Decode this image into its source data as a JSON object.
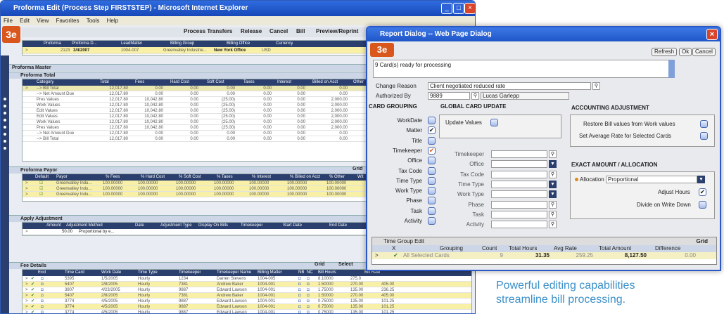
{
  "ie": {
    "title": "Proforma Edit (Process Step FIRSTSTEP) - Microsoft Internet Explorer",
    "menu": [
      "File",
      "Edit",
      "View",
      "Favorites",
      "Tools",
      "Help"
    ],
    "toolbar": [
      "Process Transfers",
      "Release",
      "Cancel",
      "Bill",
      "Preview/Reprint"
    ],
    "proforma_cols": [
      "Proforma",
      "Proforma D...",
      "LeadMatter",
      "Billing Group",
      "Billing Office",
      "Currency"
    ],
    "proforma_row": [
      "2123",
      "3/4/2007",
      "1004-007",
      "Greenvalley Industrie...",
      "New York Office",
      "USD"
    ],
    "proforma_master": "Proforma Master",
    "proforma_total": "Proforma Total",
    "total_cols": [
      "Category",
      "Total",
      "Fees",
      "Hard Cost",
      "Soft Cost",
      "Taxes",
      "Interest",
      "Billed on Acct",
      "Other"
    ],
    "total_rows": [
      [
        "--> Bill Total",
        "12,017.80",
        "0.00",
        "0.00",
        "0.00",
        "0.00",
        "0.00",
        "0.00",
        "0."
      ],
      [
        "--> Net Amount Due",
        "12,017.80",
        "0.00",
        "0.00",
        "0.00",
        "0.00",
        "0.00",
        "0.00",
        "0."
      ],
      [
        "Pres Values",
        "12,017.80",
        "10,042.80",
        "0.00",
        "(25.00)",
        "0.00",
        "0.00",
        "2,000.00",
        "0."
      ],
      [
        "Work Values",
        "12,017.80",
        "10,042.80",
        "0.00",
        "(25.00)",
        "0.00",
        "0.00",
        "2,000.00",
        "0."
      ],
      [
        "Edit Values",
        "12,017.80",
        "10,042.80",
        "0.00",
        "(25.00)",
        "0.00",
        "0.00",
        "2,000.00",
        "0."
      ],
      [
        "Edit Values",
        "12,017.80",
        "10,042.80",
        "0.00",
        "(25.00)",
        "0.00",
        "0.00",
        "2,000.00",
        "0."
      ],
      [
        "Work Values",
        "12,017.80",
        "10,042.80",
        "0.00",
        "(25.00)",
        "0.00",
        "0.00",
        "2,000.00",
        "0."
      ],
      [
        "Pres Values",
        "12,017.80",
        "10,042.80",
        "0.00",
        "(25.00)",
        "0.00",
        "0.00",
        "2,000.00",
        "0."
      ],
      [
        "--> Net Amount Due",
        "12,017.80",
        "0.00",
        "0.00",
        "0.00",
        "0.00",
        "0.00",
        "0.00",
        "0."
      ],
      [
        "--> Bill Total",
        "12,017.80",
        "0.00",
        "0.00",
        "0.00",
        "0.00",
        "0.00",
        "0.00",
        "0."
      ]
    ],
    "payor_title": "Proforma Payor",
    "payor_grid": "Grid",
    "payor_cols": [
      "Default",
      "Payor",
      "% Fees",
      "% Hard Cost",
      "% Soft Cost",
      "% Taxes",
      "% Interest",
      "% Billed on Acct",
      "% Other",
      "Wit"
    ],
    "payor_rows": [
      [
        "Greenvalley Indu...",
        "100.00000",
        "100.00000",
        "100.00000",
        "100.00000",
        "100.00000",
        "100.00000",
        "100.00000"
      ],
      [
        "Greenvalley Indu...",
        "100.00000",
        "100.00000",
        "100.00000",
        "100.00000",
        "100.00000",
        "100.00000",
        "100.00000"
      ],
      [
        "Greenvalley Indu...",
        "100.00000",
        "100.00000",
        "100.00000",
        "100.00000",
        "100.00000",
        "100.00000",
        "100.00000"
      ]
    ],
    "adjust_title": "Apply Adjustment",
    "adjust_cols": [
      "Amount",
      "Adjustment Method",
      "Date",
      "Adjustment Type",
      "Display On Bills",
      "Timekeeper",
      "Start Date",
      "End Date",
      "Time"
    ],
    "adjust_row": [
      "50.00",
      "Proportional by e..."
    ],
    "fee_title": "Fee Details",
    "fee_grid": "Grid",
    "fee_select": "Select",
    "fee_cols": [
      "Excl",
      "Time Card",
      "Work Date",
      "Time Type",
      "Timekeeper",
      "Timekeeper Name",
      "Billing Matter",
      "NB",
      "NC",
      "Bill Hours",
      "Bill Rate"
    ],
    "fee_rows": [
      [
        "5395",
        "1/5/2005",
        "Hourly",
        "1234",
        "Darren Stevens",
        "1004-005",
        "8.10000",
        "275.0",
        ""
      ],
      [
        "5407",
        "2/8/2005",
        "Hourly",
        "7381",
        "Andrew Baker",
        "1004-001",
        "1.50000",
        "270.00",
        "405.00"
      ],
      [
        "3807",
        "4/23/2005",
        "Hourly",
        "9887",
        "Edward Lawson",
        "1004-001",
        "1.75000",
        "135.00",
        "236.25"
      ],
      [
        "5407",
        "2/8/2005",
        "Hourly",
        "7381",
        "Andrew Baker",
        "1004-001",
        "1.50000",
        "270.00",
        "405.00"
      ],
      [
        "3774",
        "4/5/2005",
        "Hourly",
        "9887",
        "Edward Lawson",
        "1004-001",
        "0.75000",
        "135.00",
        "101.25"
      ],
      [
        "3774",
        "4/5/2005",
        "Hourly",
        "9887",
        "Edward Lawson",
        "1004-001",
        "0.75000",
        "135.00",
        "101.25"
      ],
      [
        "3774",
        "4/5/2005",
        "Hourly",
        "9887",
        "Edward Lawson",
        "1004-001",
        "0.75000",
        "135.00",
        "101.25"
      ],
      [
        "3807",
        "4/23/2005",
        "Hourly",
        "9887",
        "Edward Lawson",
        "1004-001",
        "1.75000",
        "135.00",
        "236.25"
      ]
    ]
  },
  "dialog": {
    "title": "Report Dialog -- Web Page Dialog",
    "buttons": [
      "Refresh",
      "Ok",
      "Cancel"
    ],
    "message": "9 Card(s) ready for processing",
    "change_reason_label": "Change Reason",
    "change_reason_value": "Client negotiated reduced rate",
    "authorized_by_label": "Authorized By",
    "authorized_by_id": "9889",
    "authorized_by_name": "Lucas Garlepp",
    "card_grouping": {
      "title": "CARD GROUPING",
      "items": [
        "WorkDate",
        "Matter",
        "Title",
        "Timekeeper",
        "Office",
        "Tax Code",
        "Time Type",
        "Work Type",
        "Phase",
        "Task",
        "Activity"
      ],
      "checked": [
        "Matter",
        "Timekeeper"
      ]
    },
    "global": {
      "title": "GLOBAL CARD UPDATE",
      "update_values": "Update Values",
      "fields": [
        "Timekeeper",
        "Office",
        "Tax Code",
        "Time Type",
        "Work Type",
        "Phase",
        "Task",
        "Activity"
      ]
    },
    "accounting": {
      "title": "ACCOUNTING ADJUSTMENT",
      "restore": "Restore Bill values from Work values",
      "set_avg": "Set Average Rate for Selected Cards"
    },
    "exact": {
      "title": "EXACT AMOUNT / ALLOCATION",
      "allocation_label": "Allocation",
      "allocation_value": "Proportional",
      "adjust_hours": "Adjust Hours",
      "divide": "Divide on Write Down"
    },
    "tge": {
      "title": "Time Group Edit",
      "grid": "Grid",
      "cols": [
        "X",
        "Grouping",
        "Count",
        "Total Hours",
        "Avg Rate",
        "Total Amount",
        "Difference"
      ],
      "row": [
        "All Selected Cards",
        "9",
        "31.35",
        "259.25",
        "8,127.50",
        "0.00"
      ]
    }
  },
  "caption": {
    "line1": "Powerful editing capabilities",
    "line2": "streamline bill processing."
  },
  "colors": {
    "accent": "#3a8fc8",
    "brand": "#d9571c",
    "title_bar": "#2a58c8",
    "header": "#2a3f6e"
  }
}
